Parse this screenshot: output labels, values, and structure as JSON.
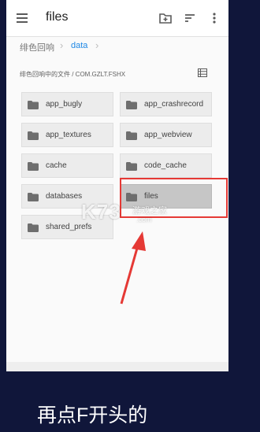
{
  "appbar": {
    "title": "files",
    "menu_icon": "hamburger-menu-icon",
    "new_folder_icon": "new-folder-icon",
    "sort_icon": "sort-icon",
    "more_icon": "more-vert-icon"
  },
  "breadcrumb": {
    "root": "绯色回响",
    "current": "data"
  },
  "path": {
    "text": "绯色回响中的文件 / COM.GZLT.FSHX",
    "view_icon": "list-view-icon"
  },
  "folders": [
    {
      "name": "app_bugly",
      "selected": false
    },
    {
      "name": "app_crashrecord",
      "selected": false
    },
    {
      "name": "app_textures",
      "selected": false
    },
    {
      "name": "app_webview",
      "selected": false
    },
    {
      "name": "cache",
      "selected": false
    },
    {
      "name": "code_cache",
      "selected": false
    },
    {
      "name": "databases",
      "selected": false
    },
    {
      "name": "files",
      "selected": true
    },
    {
      "name": "shared_prefs",
      "selected": false
    }
  ],
  "watermark": {
    "logo": "K73",
    "sub": "游戏之家",
    "url": ".com"
  },
  "annotation": {
    "highlight_color": "#e53935",
    "caption": "再点F开头的"
  }
}
